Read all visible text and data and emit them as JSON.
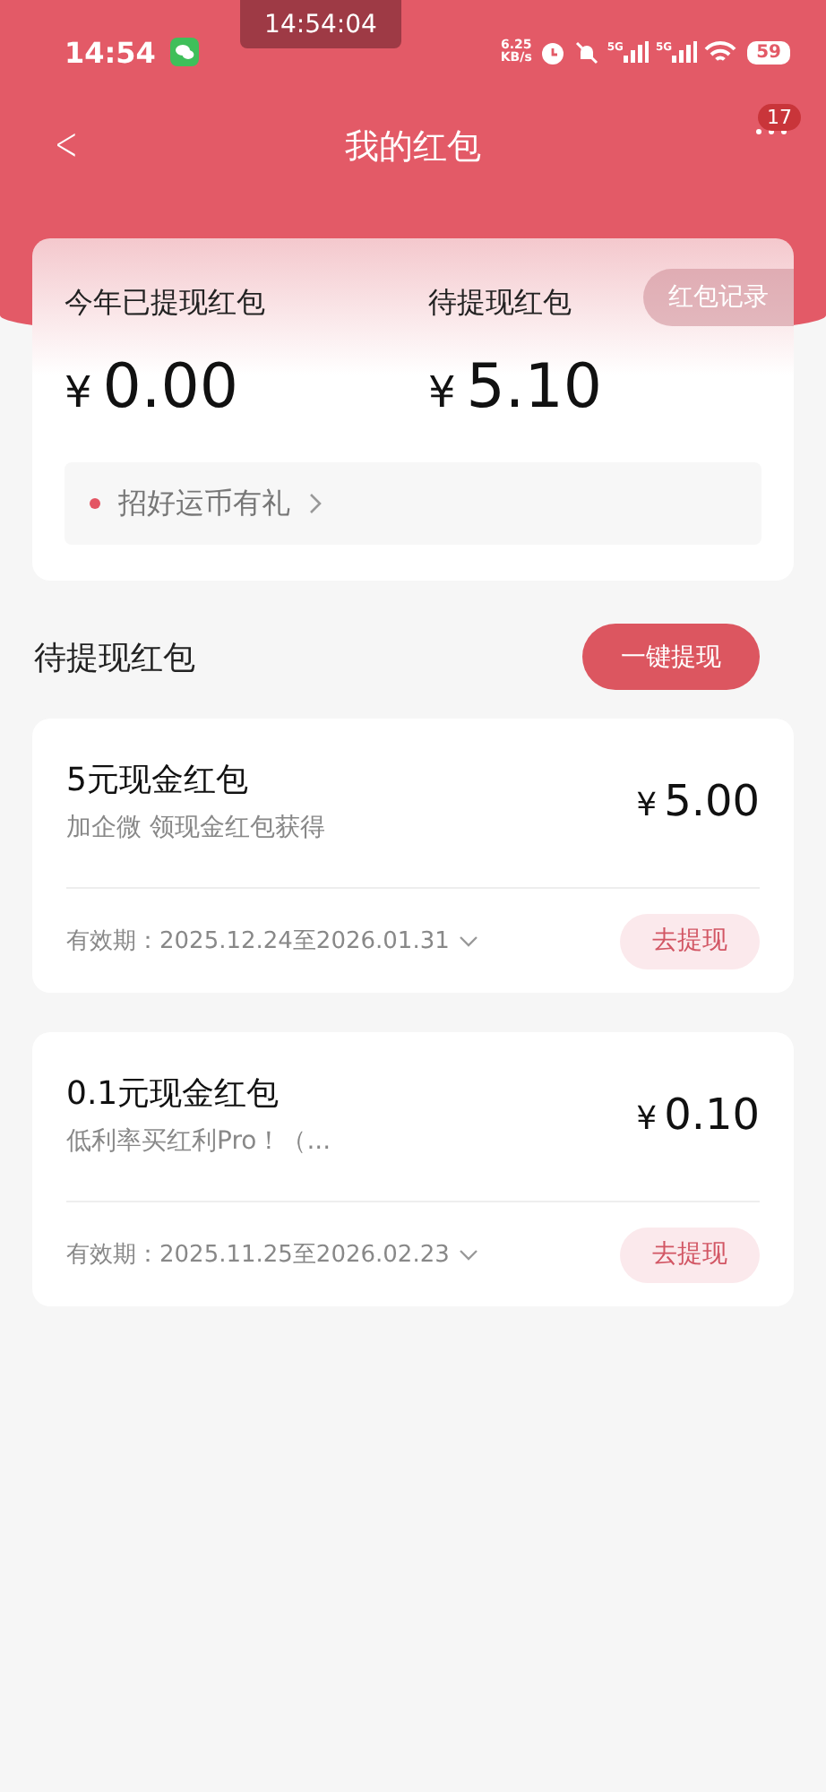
{
  "status_bar": {
    "time": "14:54",
    "overlay_time": "14:54:04",
    "network_speed": "6.25",
    "network_unit": "KB/s",
    "signal_labels": [
      "5G",
      "5G"
    ],
    "battery": "59"
  },
  "nav": {
    "back": "<",
    "title": "我的红包",
    "more_badge": "17"
  },
  "summary": {
    "record_button": "红包记录",
    "stats": [
      {
        "label": "今年已提现红包",
        "currency": "¥",
        "amount": "0.00"
      },
      {
        "label": "待提现红包",
        "currency": "¥",
        "amount": "5.10"
      }
    ],
    "promo": {
      "text": "招好运币有礼",
      "color": "#e35563"
    }
  },
  "section": {
    "title": "待提现红包",
    "action": "一键提现"
  },
  "packets": [
    {
      "title": "5元现金红包",
      "subtitle": "加企微 领现金红包获得",
      "currency": "¥",
      "amount": "5.00",
      "validity": "有效期：2025.12.24至2026.01.31",
      "button": "去提现"
    },
    {
      "title": "0.1元现金红包",
      "subtitle": "低利率买红利Pro！（...",
      "currency": "¥",
      "amount": "0.10",
      "validity": "有效期：2025.11.25至2026.02.23",
      "button": "去提现"
    }
  ]
}
